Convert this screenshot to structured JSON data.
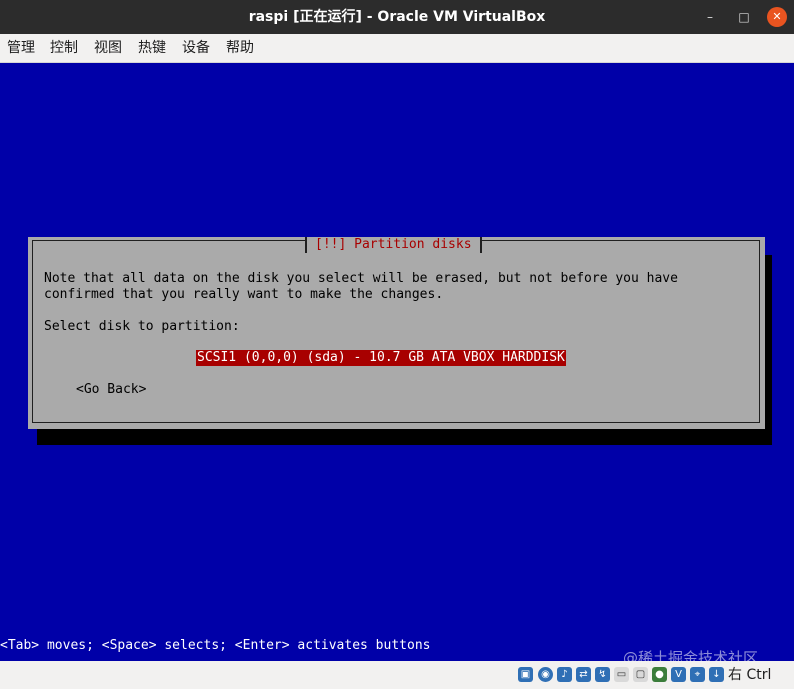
{
  "window": {
    "title": "raspi [正在运行] - Oracle VM VirtualBox",
    "minimize": "–",
    "maximize": "□",
    "close": "✕"
  },
  "menu": [
    "管理",
    "控制",
    "视图",
    "热键",
    "设备",
    "帮助"
  ],
  "installer": {
    "dialog_title": "[!!] Partition disks",
    "message_line1": "Note that all data on the disk you select will be erased, but not before you have",
    "message_line2": "confirmed that you really want to make the changes.",
    "prompt": "Select disk to partition:",
    "disk_option": "SCSI1 (0,0,0) (sda) - 10.7 GB ATA VBOX HARDDISK",
    "go_back": "<Go Back>",
    "help_line": "<Tab> moves; <Space> selects; <Enter> activates buttons"
  },
  "statusbar": {
    "icons": [
      "hard-disk-icon",
      "optical-drive-icon",
      "audio-icon",
      "network-icon",
      "usb-icon",
      "shared-folder-icon",
      "display-icon",
      "screen-record-icon",
      "virtualization-icon",
      "mouse-integration-icon"
    ],
    "host_key": "右 Ctrl"
  },
  "watermark": "@稀土掘金技术社区"
}
